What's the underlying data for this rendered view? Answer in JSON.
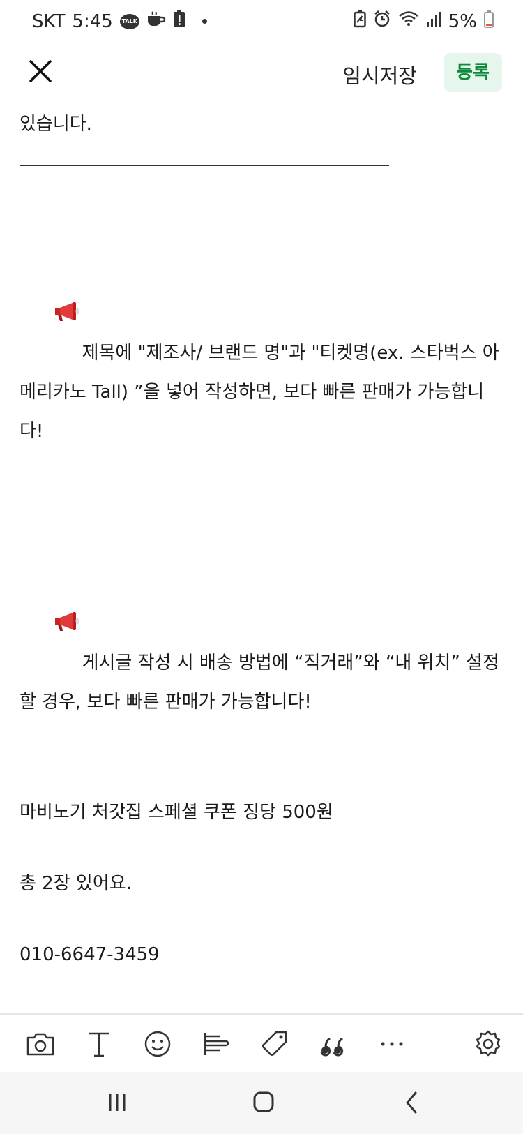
{
  "status": {
    "carrier": "SKT",
    "time": "5:45",
    "talk_badge": "TALK",
    "battery": "5%",
    "icons": [
      "kakaotalk-icon",
      "coffee-icon",
      "alert-icon",
      "dot-icon",
      "battery-saver-icon",
      "alarm-icon",
      "wifi-icon",
      "signal-icon",
      "battery-icon"
    ]
  },
  "header": {
    "close_icon": "close-icon",
    "temp_save_label": "임시저장",
    "submit_label": "등록",
    "accent_color": "#0d8a3a"
  },
  "content": {
    "line1": "있습니다.",
    "notice1": "제목에 \"제조사/ 브랜드 명\"과 \"티켓명(ex. 스타벅스 아메리카노 Tall) ”을 넣어 작성하면, 보다 빠른 판매가 가능합니다!",
    "notice2": "게시글 작성 시 배송 방법에 “직거래”와 “내 위치” 설정할 경우, 보다 빠른 판매가 가능합니다!",
    "item": "마비노기 처갓집 스페셜 쿠폰 징당 500원",
    "quantity": "총 2장 있어요.",
    "phone": "010-6647-3459"
  },
  "toolbar": {
    "icons": [
      "camera-icon",
      "text-icon",
      "emoji-icon",
      "align-icon",
      "tag-icon",
      "quote-icon",
      "more-icon",
      "settings-icon"
    ]
  },
  "navbar": {
    "icons": [
      "recent-apps-icon",
      "home-icon",
      "back-icon"
    ]
  }
}
